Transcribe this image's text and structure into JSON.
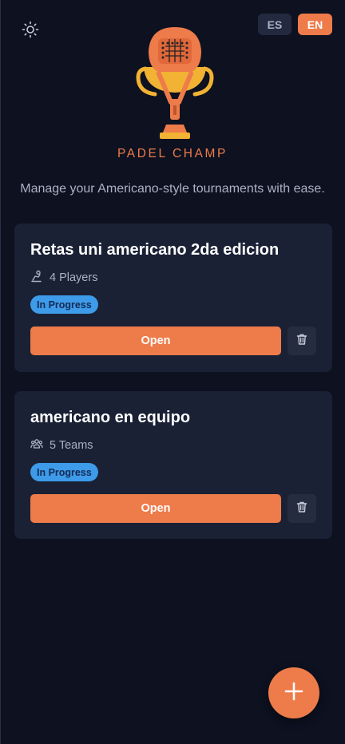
{
  "header": {
    "theme_icon": "sun-icon",
    "languages": [
      "ES",
      "EN"
    ],
    "active_language": "EN"
  },
  "brand": {
    "name": "PADEL CHAMP",
    "logo_icon": "padel-trophy-logo",
    "tagline": "Manage your Americano-style tournaments with ease."
  },
  "tournaments": [
    {
      "title": "Retas uni americano 2da edicion",
      "participants_icon": "player-icon",
      "participants": "4 Players",
      "status": "In Progress",
      "open_label": "Open",
      "delete_icon": "trash-icon"
    },
    {
      "title": "americano en equipo",
      "participants_icon": "team-icon",
      "participants": "5 Teams",
      "status": "In Progress",
      "open_label": "Open",
      "delete_icon": "trash-icon"
    }
  ],
  "fab": {
    "icon": "plus-icon"
  },
  "colors": {
    "background": "#0d1120",
    "card": "#1a2135",
    "accent": "#ee7b4a",
    "badge": "#3d9be9",
    "muted_text": "#aab1c3"
  }
}
